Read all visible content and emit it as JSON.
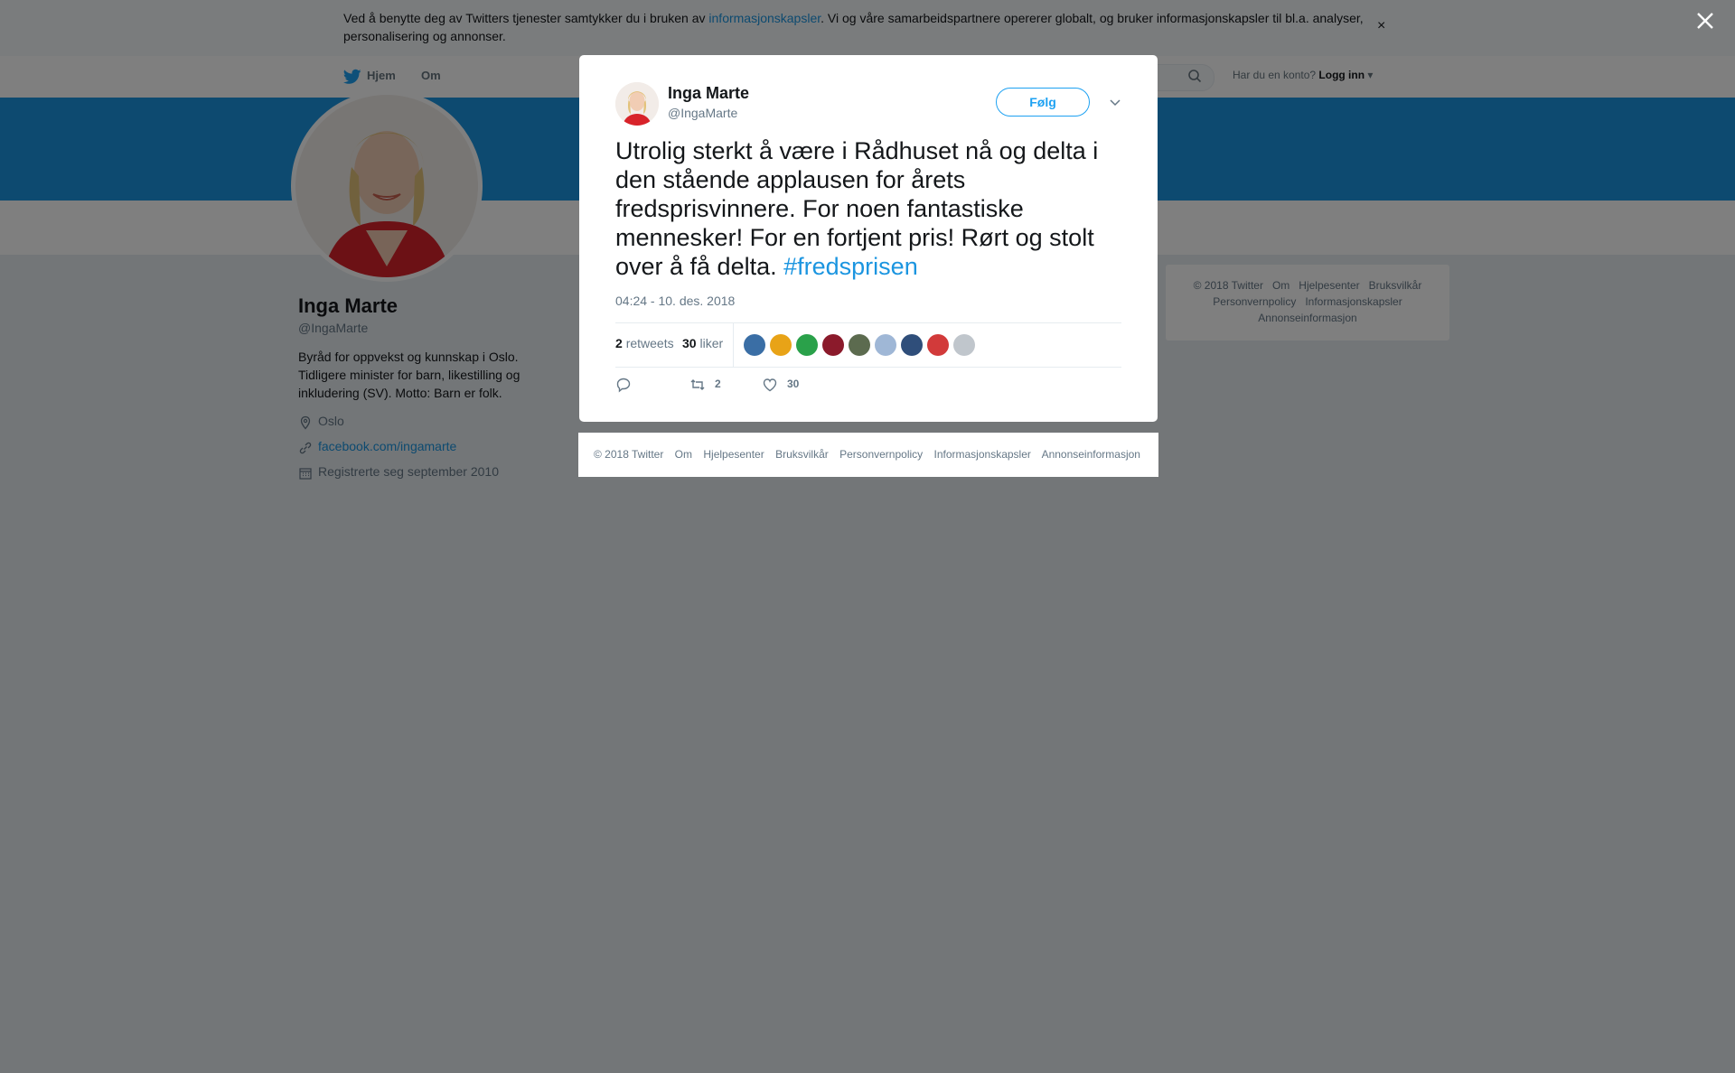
{
  "cookie": {
    "text_before": "Ved å benytte deg av Twitters tjenester samtykker du i bruken av ",
    "link": "informasjonskapsler",
    "text_after": ". Vi og våre samarbeidspartnere opererer globalt, og bruker informasjonskapsler til bl.a. analyser, personalisering og annonser.",
    "close": "×"
  },
  "nav": {
    "home": "Hjem",
    "about": "Om",
    "login_prompt": "Har du en konto?",
    "login": "Logg inn"
  },
  "profile": {
    "name": "Inga Marte",
    "handle": "@IngaMarte",
    "bio": "Byråd for oppvekst og kunnskap i Oslo. Tidligere minister for barn, likestilling og inkludering (SV). Motto: Barn er folk.",
    "location": "Oslo",
    "url": "facebook.com/ingamarte",
    "joined": "Registrerte seg september 2010"
  },
  "side_footer": [
    "© 2018 Twitter",
    "Om",
    "Hjelpesenter",
    "Bruksvilkår",
    "Personvernpolicy",
    "Informasjonskapsler",
    "Annonseinformasjon"
  ],
  "tweet": {
    "name": "Inga Marte",
    "handle": "@IngaMarte",
    "follow": "Følg",
    "text": "Utrolig sterkt å være i Rådhuset nå og delta i den stående applausen for årets fredsprisvinnere. For noen fantastiske mennesker! For en fortjent pris! Rørt og stolt over å få delta. ",
    "hashtag": "#fredsprisen",
    "timestamp": "04:24 - 10. des. 2018",
    "retweets_count": "2",
    "retweets_label": "retweets",
    "likes_count": "30",
    "likes_label": "liker",
    "liker_colors": [
      "#3a6ea5",
      "#e8a317",
      "#2aa14a",
      "#8b1a2b",
      "#5c6b4f",
      "#9fb7d6",
      "#2f4e7a",
      "#d23a3a",
      "#c0c6cc"
    ],
    "action_retweets": "2",
    "action_likes": "30"
  },
  "modal_footer": [
    "© 2018 Twitter",
    "Om",
    "Hjelpesenter",
    "Bruksvilkår",
    "Personvernpolicy",
    "Informasjonskapsler",
    "Annonseinformasjon"
  ]
}
